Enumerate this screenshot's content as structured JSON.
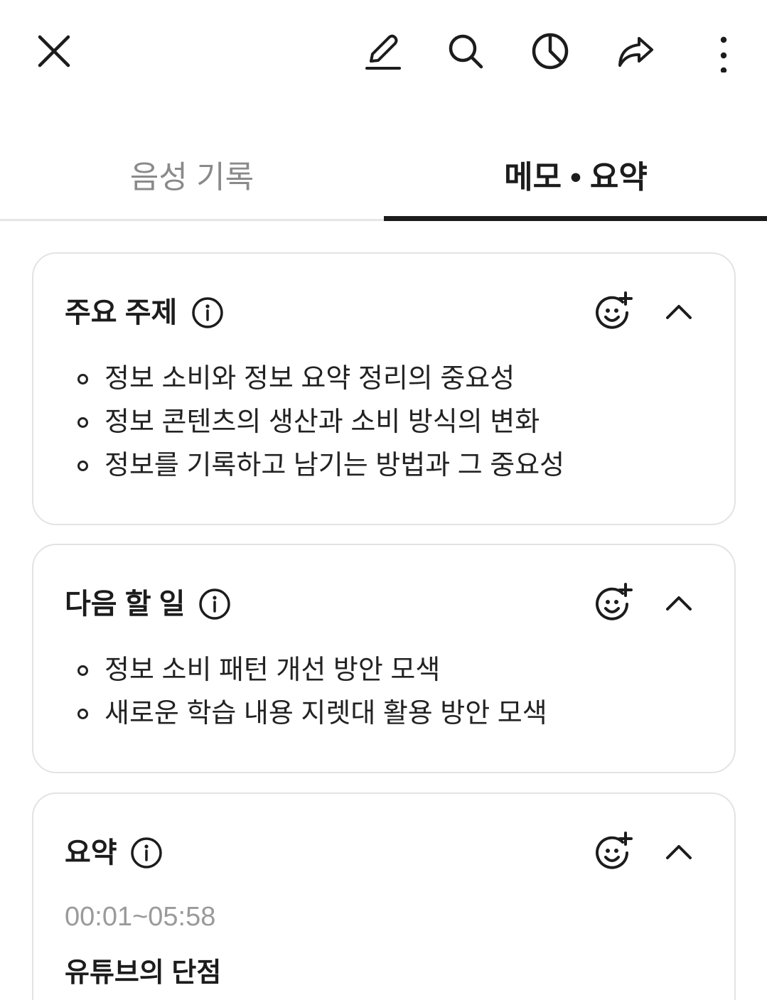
{
  "toolbar": {
    "close_icon": "close-icon",
    "edit_icon": "pencil-icon",
    "search_icon": "search-icon",
    "stats_icon": "pie-chart-icon",
    "share_icon": "share-icon",
    "more_icon": "more-vertical-icon"
  },
  "tabs": [
    {
      "label": "음성 기록",
      "active": false
    },
    {
      "label": "메모 • 요약",
      "active": true
    }
  ],
  "cards": [
    {
      "title": "주요 주제",
      "items": [
        "정보 소비와 정보 요약 정리의 중요성",
        "정보 콘텐츠의 생산과 소비 방식의 변화",
        "정보를 기록하고 남기는 방법과 그 중요성"
      ]
    },
    {
      "title": "다음 할 일",
      "items": [
        "정보 소비 패턴 개선 방안 모색",
        "새로운 학습 내용 지렛대 활용 방안 모색"
      ]
    },
    {
      "title": "요약",
      "time_range": "00:01~05:58",
      "heading": "유튜브의 단점"
    }
  ],
  "colors": {
    "text_primary": "#1c1c1c",
    "text_secondary": "#8a8a8a",
    "border": "#e3e3e3",
    "indicator": "#1c1c1c"
  }
}
